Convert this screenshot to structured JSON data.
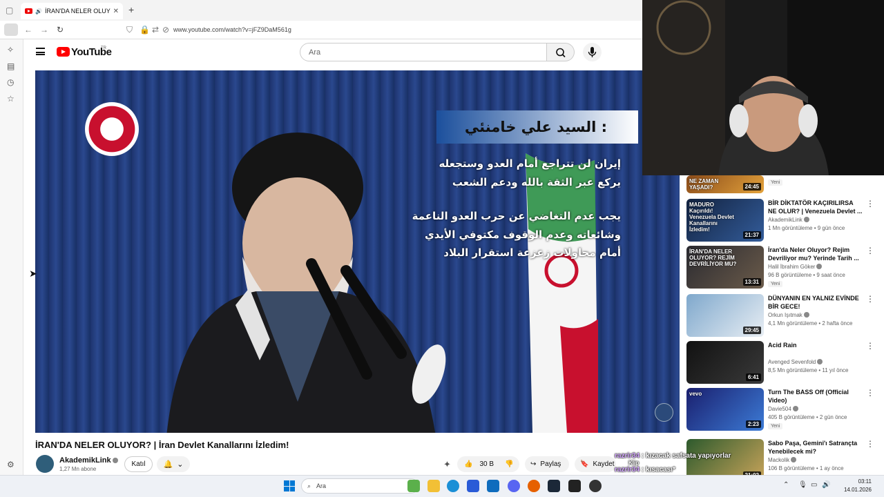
{
  "browser": {
    "tab_title": "İRAN'DA NELER OLUYOR? | İ",
    "url": "www.youtube.com/watch?v=jFZ9DaM561g"
  },
  "youtube": {
    "wordmark": "YouTube",
    "country_code": "TR",
    "search_placeholder": "Ara"
  },
  "video": {
    "overlay_heading": "السيد علي خامنئي :",
    "overlay_lines": [
      "إيران لن تتراجع أمام العدو وستجعله",
      "يركع عبر الثقة بالله ودعم الشعب",
      "يجب عدم التغاضي عن حرب العدو الناعمة",
      "وشائعاته وعدم الوقوف مكتوفي الأيدي",
      "أمام محاولات زعزعة استقرار البلاد"
    ],
    "title": "İRAN'DA NELER OLUYOR? | İran Devlet Kanallarını İzledim!",
    "channel_name": "AkademikLink",
    "subscribers": "1,27 Mn abone",
    "join_label": "Katıl",
    "likes": "30 B",
    "share_label": "Paylaş",
    "save_label": "Kaydet"
  },
  "recommendations": [
    {
      "thumb_text": "NE ZAMAN YAŞADI?",
      "duration": "24:45",
      "title": "",
      "channel": "",
      "stats": "",
      "badge": "Yeni",
      "colors": [
        "#8a4b1a",
        "#e3a23b"
      ]
    },
    {
      "thumb_text": "MADURO Kaçırıldı! Venezuela Devlet Kanallarını İzledim!",
      "duration": "21:37",
      "title": "BİR DİKTATÖR KAÇIRILIRSA NE OLUR? | Venezuela Devlet ...",
      "channel": "AkademikLink",
      "stats": "1 Mn görüntüleme • 9 gün önce",
      "badge": "",
      "colors": [
        "#12223f",
        "#335c9a"
      ]
    },
    {
      "thumb_text": "İRAN'DA NELER OLUYOR? REJİM DEVRİLİYOR MU?",
      "duration": "13:31",
      "title": "İran'da Neler Oluyor? Rejim Devriliyor mu? Yerinde Tarih ...",
      "channel": "Halil İbrahim Göker",
      "stats": "96 B görüntüleme • 9 saat önce",
      "badge": "Yeni",
      "colors": [
        "#2a2a30",
        "#6b5b4a"
      ]
    },
    {
      "thumb_text": "",
      "duration": "29:45",
      "title": "DÜNYANIN EN YALNIZ EVİNDE BİR GECE!",
      "channel": "Orkun Işıtmak",
      "stats": "4,1 Mn görüntüleme • 2 hafta önce",
      "badge": "",
      "colors": [
        "#7fa8cc",
        "#e8eef4"
      ]
    },
    {
      "thumb_text": "",
      "duration": "6:41",
      "title": "Acid Rain",
      "channel": "Avenged Sevenfold",
      "stats": "8,5 Mn görüntüleme • 11 yıl önce",
      "badge": "",
      "colors": [
        "#111111",
        "#3a3a3a"
      ]
    },
    {
      "thumb_text": "vevo",
      "duration": "2:23",
      "title": "Turn The BASS Off (Official Video)",
      "channel": "Davie504",
      "stats": "405 B görüntüleme • 2 gün önce",
      "badge": "Yeni",
      "colors": [
        "#1a1f6e",
        "#3c7bd6"
      ]
    },
    {
      "thumb_text": "",
      "duration": "21:02",
      "title": "Sabo Paşa, Gemini'ı Satrançta Yenebilecek mi?",
      "channel": "Mackolik",
      "stats": "106 B görüntüleme • 1 ay önce",
      "badge": "",
      "colors": [
        "#2d5a2d",
        "#c9a45a"
      ]
    }
  ],
  "chat": [
    {
      "user": "razrir34",
      "text": ": kızacak safsata yapıyorlar"
    },
    {
      "user": "razrir34",
      "text": ": kısacası*"
    }
  ],
  "overlay_clip_label": "Klip",
  "taskbar": {
    "search_placeholder": "Ara",
    "time": "03:11",
    "date": "14.01.2026"
  }
}
